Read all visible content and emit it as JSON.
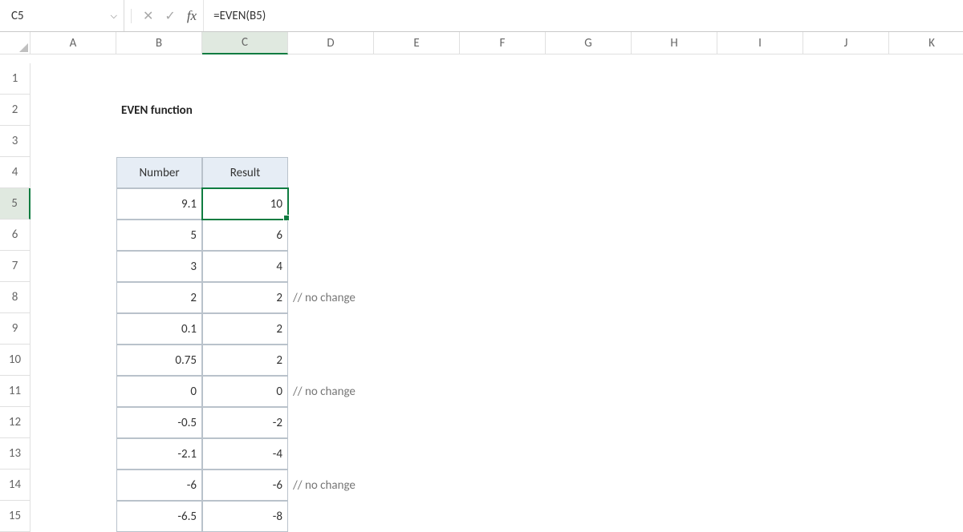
{
  "name_box": "C5",
  "formula": "=EVEN(B5)",
  "columns": [
    "A",
    "B",
    "C",
    "D",
    "E",
    "F",
    "G",
    "H",
    "I",
    "J",
    "K"
  ],
  "rows": [
    1,
    2,
    3,
    4,
    5,
    6,
    7,
    8,
    9,
    10,
    11,
    12,
    13,
    14,
    15
  ],
  "active_col": "C",
  "active_row": 5,
  "title": "EVEN function",
  "table": {
    "headers": [
      "Number",
      "Result"
    ],
    "rows": [
      {
        "number": "9.1",
        "result": "10",
        "note": ""
      },
      {
        "number": "5",
        "result": "6",
        "note": ""
      },
      {
        "number": "3",
        "result": "4",
        "note": ""
      },
      {
        "number": "2",
        "result": "2",
        "note": "// no change"
      },
      {
        "number": "0.1",
        "result": "2",
        "note": ""
      },
      {
        "number": "0.75",
        "result": "2",
        "note": ""
      },
      {
        "number": "0",
        "result": "0",
        "note": "// no change"
      },
      {
        "number": "-0.5",
        "result": "-2",
        "note": ""
      },
      {
        "number": "-2.1",
        "result": "-4",
        "note": ""
      },
      {
        "number": "-6",
        "result": "-6",
        "note": "// no change"
      },
      {
        "number": "-6.5",
        "result": "-8",
        "note": ""
      }
    ]
  }
}
